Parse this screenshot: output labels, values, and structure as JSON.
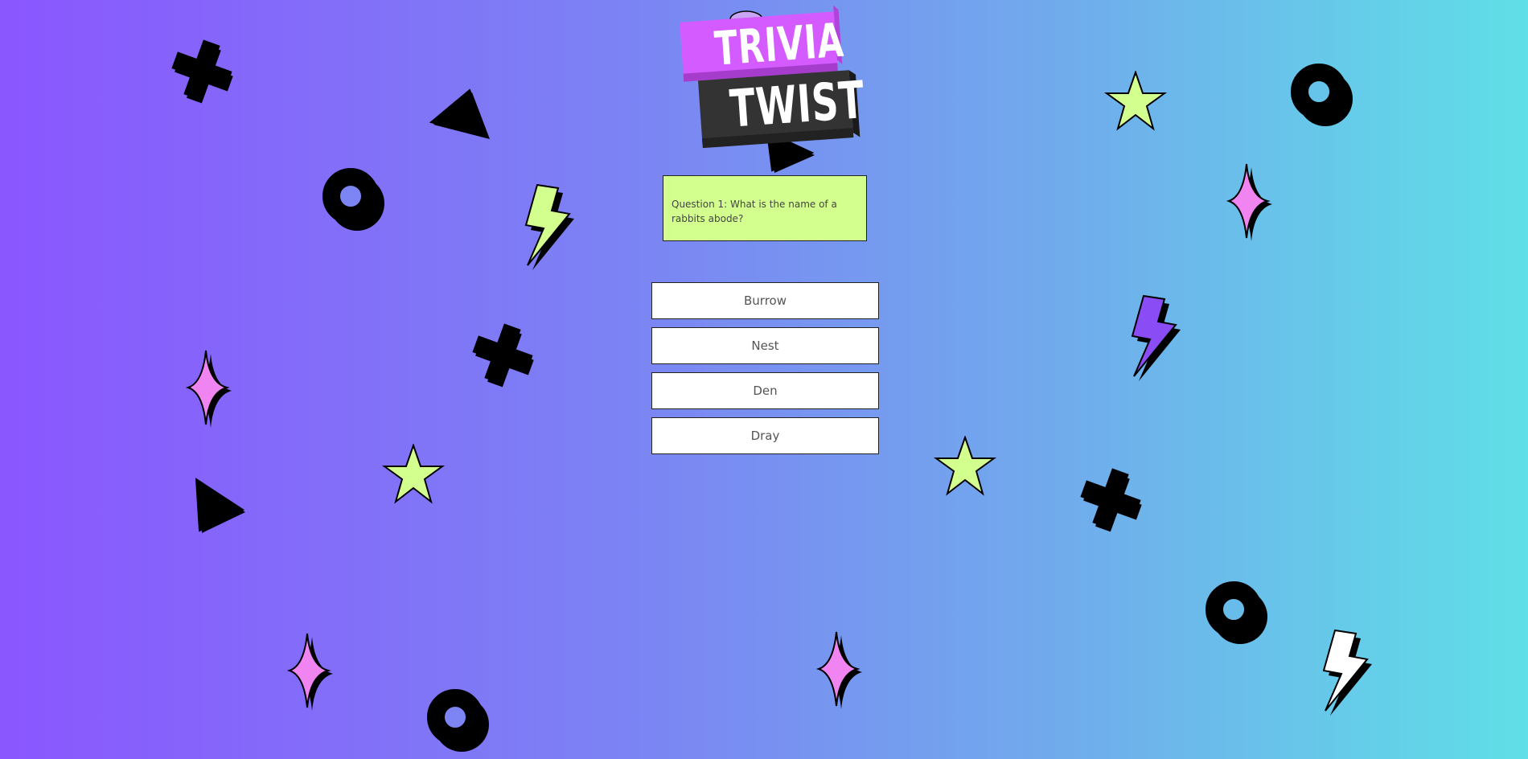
{
  "logo": {
    "line1": "TRIVIA",
    "line2": "TWIST"
  },
  "question": {
    "text": "Question 1: What is the name of a rabbits abode?"
  },
  "answers": [
    {
      "label": "Burrow"
    },
    {
      "label": "Nest"
    },
    {
      "label": "Den"
    },
    {
      "label": "Dray"
    }
  ],
  "colors": {
    "gradient_start": "#8a56fe",
    "gradient_end": "#5fdfe7",
    "question_bg": "#d3ff8e",
    "logo_top": "#d35bff",
    "logo_bottom": "#333333"
  }
}
